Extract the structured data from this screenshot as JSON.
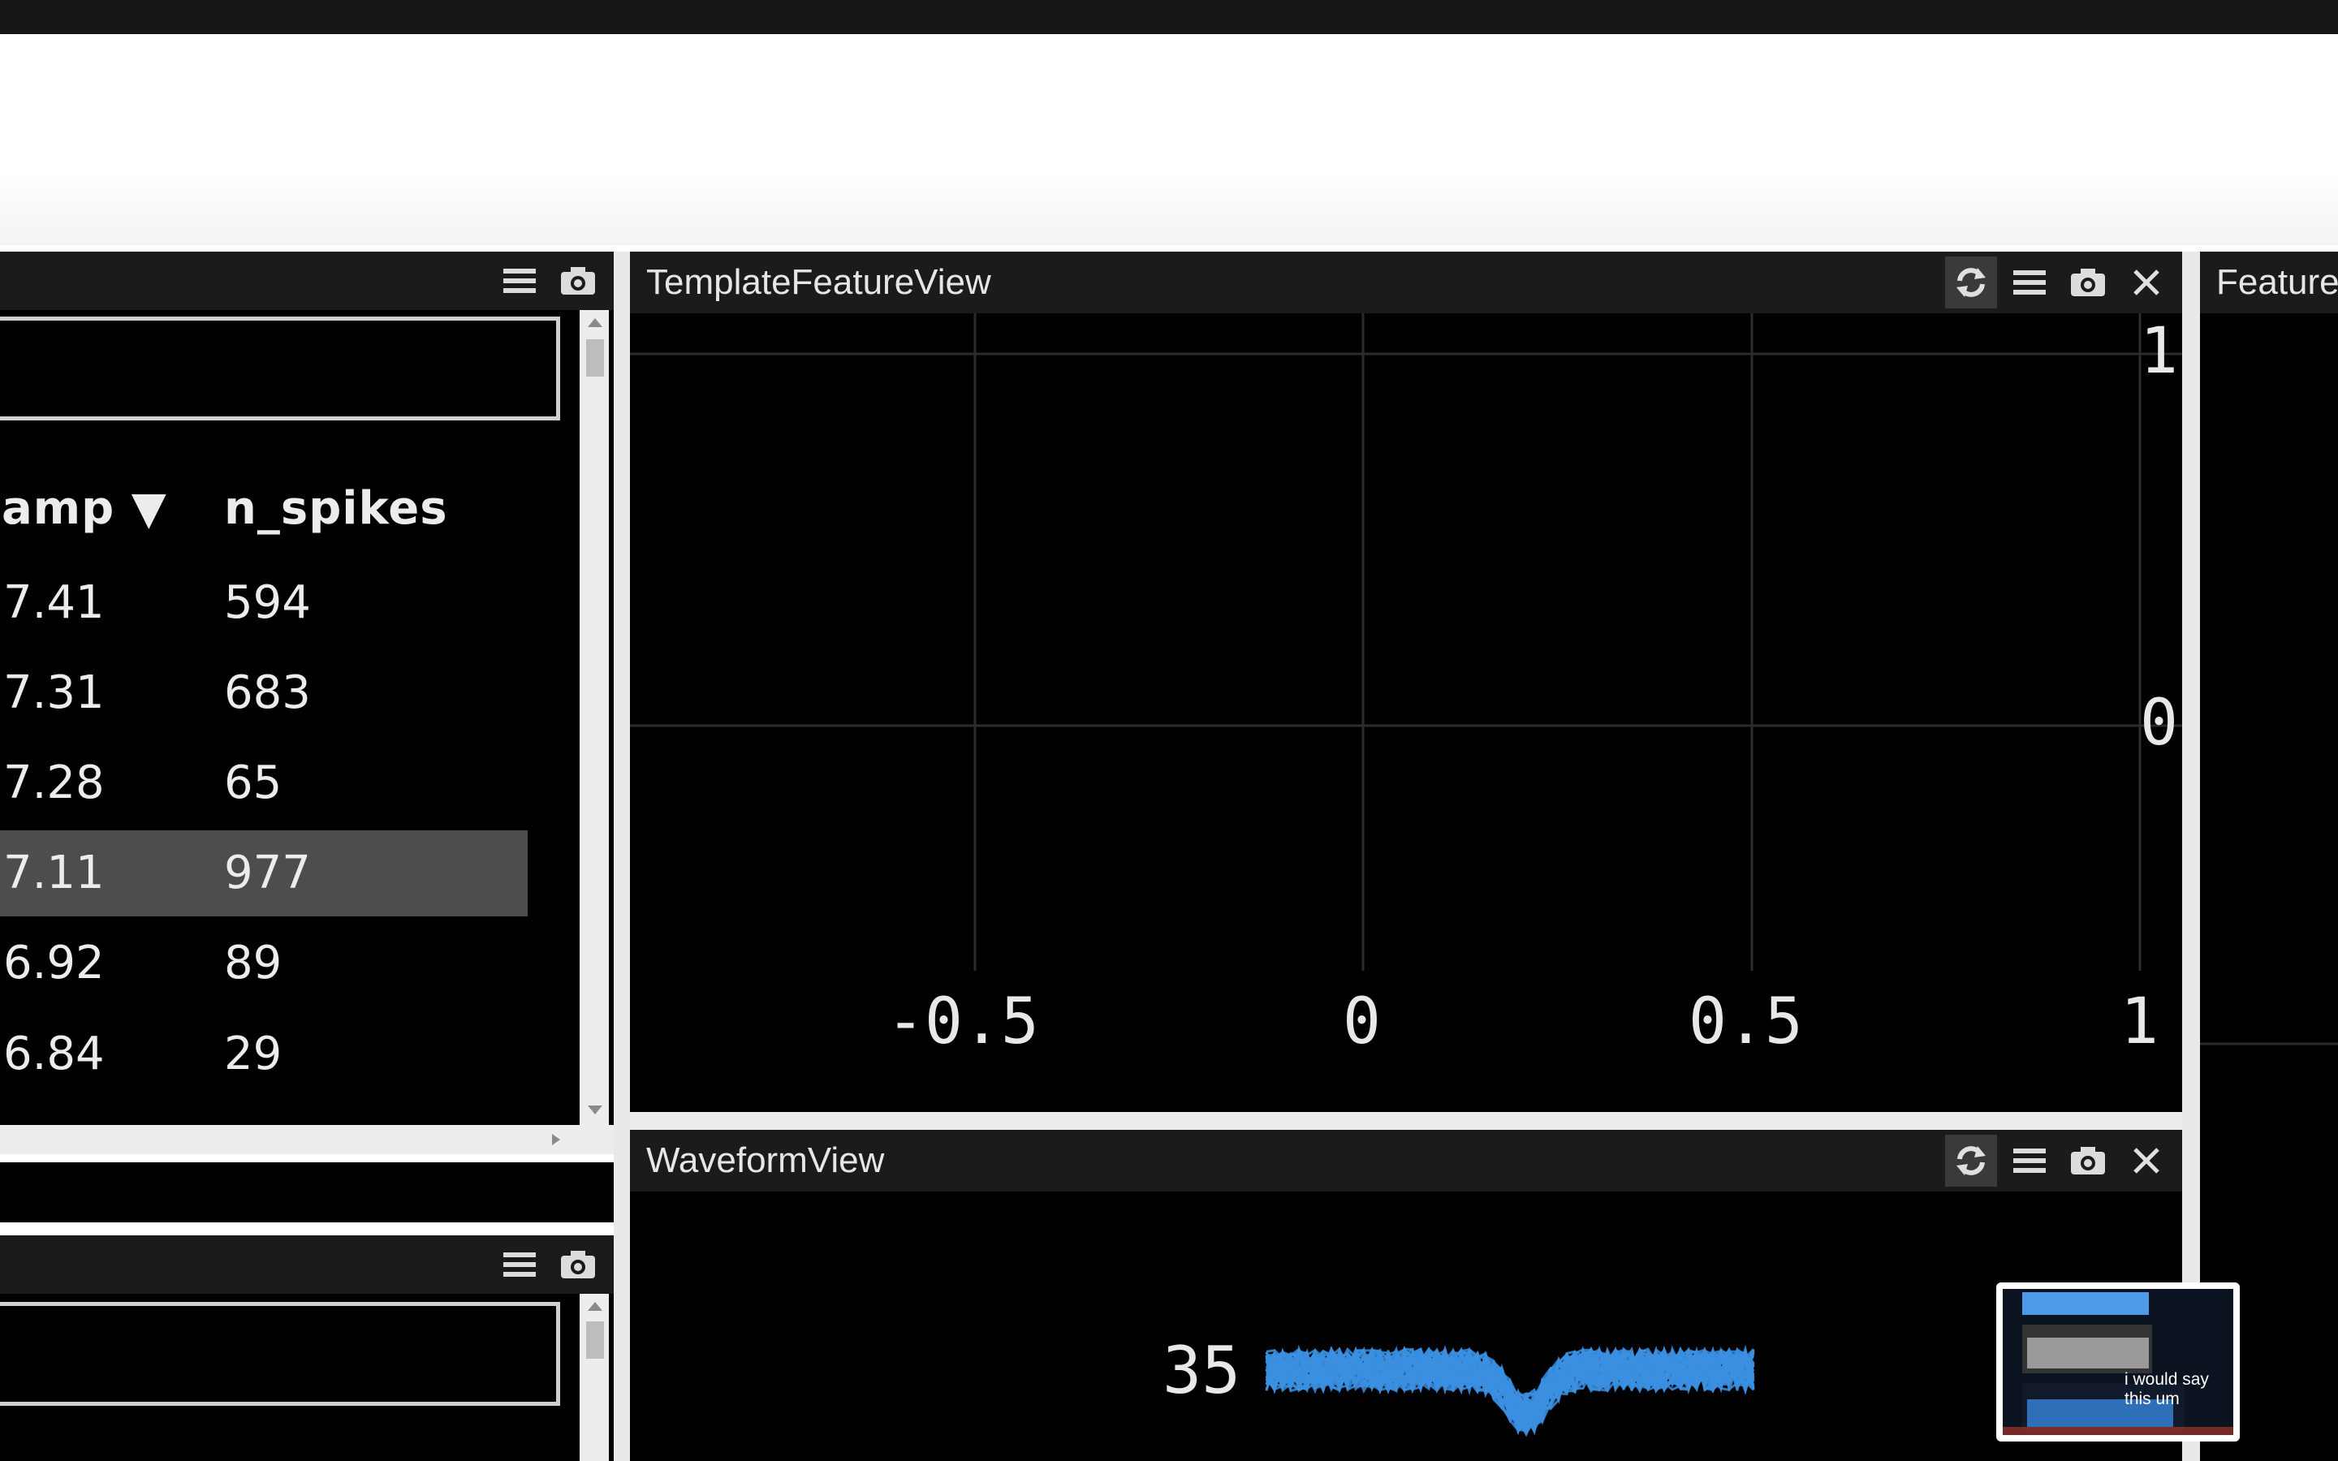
{
  "left_top_panel": {
    "columns": [
      "amp ▼",
      "n_spikes"
    ],
    "rows": [
      {
        "amp": "7.41",
        "n_spikes": "594",
        "selected": false
      },
      {
        "amp": "7.31",
        "n_spikes": "683",
        "selected": false
      },
      {
        "amp": "7.28",
        "n_spikes": "65",
        "selected": false
      },
      {
        "amp": "7.11",
        "n_spikes": "977",
        "selected": true
      },
      {
        "amp": "6.92",
        "n_spikes": "89",
        "selected": false
      },
      {
        "amp": "6.84",
        "n_spikes": "29",
        "selected": false
      }
    ]
  },
  "template_feature_view": {
    "title": "TemplateFeatureView",
    "x_ticks": [
      "-0.5",
      "0",
      "0.5",
      "1"
    ],
    "y_ticks": [
      "1",
      "0"
    ]
  },
  "waveform_view": {
    "title": "WaveformView",
    "channel_label": "35",
    "waveform_color": "#3b8fe0"
  },
  "feature_view": {
    "title": "FeatureV"
  },
  "pip_overlay": {
    "caption": "i would say this um"
  },
  "icons": [
    "refresh-icon",
    "menu-icon",
    "camera-icon",
    "close-icon"
  ]
}
